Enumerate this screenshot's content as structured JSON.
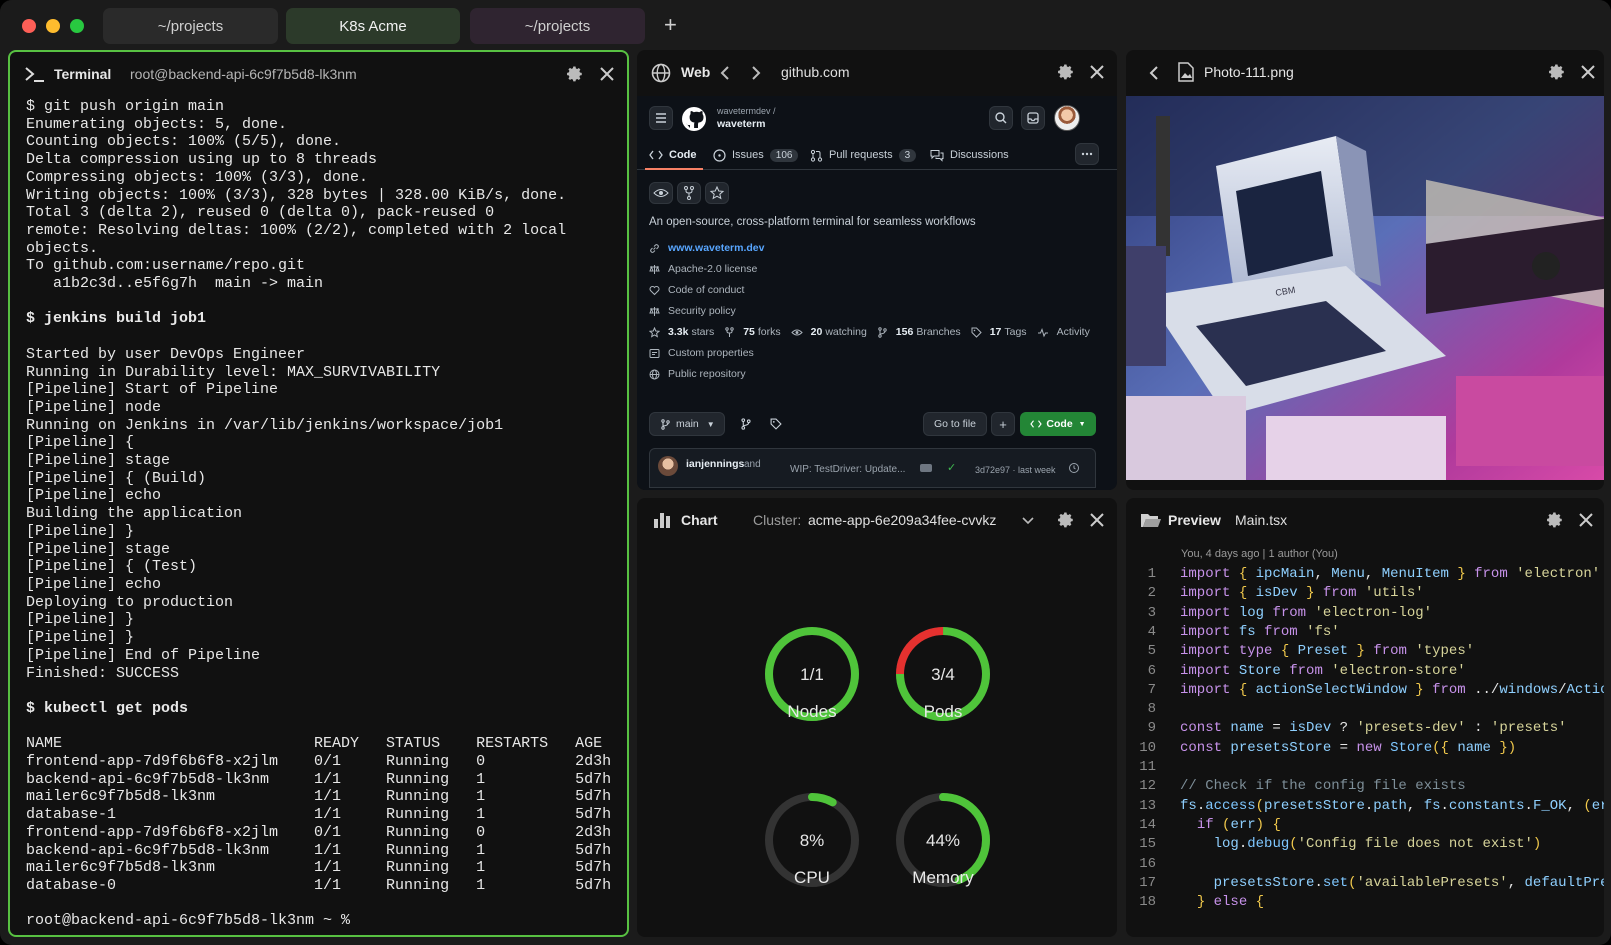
{
  "tabs": [
    {
      "label": "~/projects"
    },
    {
      "label": "K8s Acme"
    },
    {
      "label": "~/projects"
    }
  ],
  "new_tab": "+",
  "terminal": {
    "title": "Terminal",
    "host": "root@backend-api-6c9f7b5d8-lk3nm",
    "lines": [
      "$ git push origin main",
      "Enumerating objects: 5, done.",
      "Counting objects: 100% (5/5), done.",
      "Delta compression using up to 8 threads",
      "Compressing objects: 100% (3/3), done.",
      "Writing objects: 100% (3/3), 328 bytes | 328.00 KiB/s, done.",
      "Total 3 (delta 2), reused 0 (delta 0), pack-reused 0",
      "remote: Resolving deltas: 100% (2/2), completed with 2 local",
      "objects.",
      "To github.com:username/repo.git",
      "   a1b2c3d..e5f6g7h  main -> main",
      "",
      "$ jenkins build job1",
      "",
      "Started by user DevOps Engineer",
      "Running in Durability level: MAX_SURVIVABILITY",
      "[Pipeline] Start of Pipeline",
      "[Pipeline] node",
      "Running on Jenkins in /var/lib/jenkins/workspace/job1",
      "[Pipeline] {",
      "[Pipeline] stage",
      "[Pipeline] { (Build)",
      "[Pipeline] echo",
      "Building the application",
      "[Pipeline] }",
      "[Pipeline] stage",
      "[Pipeline] { (Test)",
      "[Pipeline] echo",
      "Deploying to production",
      "[Pipeline] }",
      "[Pipeline] }",
      "[Pipeline] End of Pipeline",
      "Finished: SUCCESS",
      "",
      "$ kubectl get pods",
      "",
      "NAME                            READY   STATUS    RESTARTS   AGE",
      "frontend-app-7d9f6b6f8-x2jlm    0/1     Running   0          2d3h",
      "backend-api-6c9f7b5d8-lk3nm     1/1     Running   1          5d7h",
      "mailer6c9f7b5d8-lk3nm           1/1     Running   1          5d7h",
      "database-1                      1/1     Running   1          5d7h",
      "frontend-app-7d9f6b6f8-x2jlm    0/1     Running   0          2d3h",
      "backend-api-6c9f7b5d8-lk3nm     1/1     Running   1          5d7h",
      "mailer6c9f7b5d8-lk3nm           1/1     Running   1          5d7h",
      "database-0                      1/1     Running   1          5d7h",
      "",
      "root@backend-api-6c9f7b5d8-lk3nm ~ %"
    ],
    "bold_lines": [
      12,
      34
    ]
  },
  "web": {
    "title": "Web",
    "url": "github.com",
    "github": {
      "owner": "wavetermdev /",
      "repo": "waveterm",
      "tabs": {
        "code": "Code",
        "issues": "Issues",
        "issues_count": "106",
        "pulls": "Pull requests",
        "pulls_count": "3",
        "discussions": "Discussions"
      },
      "description": "An open-source, cross-platform terminal for seamless workflows",
      "website": "www.waveterm.dev",
      "license": "Apache-2.0 license",
      "conduct": "Code of conduct",
      "security": "Security policy",
      "stars_n": "3.3k",
      "stars": "stars",
      "forks_n": "75",
      "forks": "forks",
      "watching_n": "20",
      "watching": "watching",
      "branches_n": "156",
      "branches": "Branches",
      "tags_n": "17",
      "tags": "Tags",
      "activity": "Activity",
      "custom": "Custom properties",
      "public": "Public repository",
      "branch": "main",
      "go_to_file": "Go to file",
      "add": "+",
      "code_btn": "Code",
      "commit_author": "ianjennings",
      "commit_and": "and",
      "commit_msg": "WIP: TestDriver: Update...",
      "commit_meta": "3d72e97 · last week"
    }
  },
  "photo": {
    "title": "Photo-111.png",
    "image_text": "CBM"
  },
  "chart": {
    "title": "Chart",
    "cluster_label": "Cluster:",
    "cluster_value": "acme-app-6e209a34fee-cvvkz",
    "colors": {
      "green": "#4fc43a",
      "red": "#e5312f",
      "track": "#333333"
    }
  },
  "chart_data": {
    "type": "gauge",
    "gauges": [
      {
        "name": "Nodes",
        "text": "1/1",
        "fraction": 1.0,
        "warn_fraction": 0
      },
      {
        "name": "Pods",
        "text": "3/4",
        "fraction": 0.75,
        "warn_fraction": 0.25
      },
      {
        "name": "CPU",
        "text": "8%",
        "fraction": 0.08,
        "warn_fraction": 0
      },
      {
        "name": "Memory",
        "text": "44%",
        "fraction": 0.44,
        "warn_fraction": 0
      }
    ]
  },
  "preview": {
    "title": "Preview",
    "file": "Main.tsx",
    "blame": "You, 4 days ago | 1 author (You)",
    "lines": [
      {
        "n": "1",
        "t": "import { ipcMain, Menu, MenuItem } from 'electron'"
      },
      {
        "n": "2",
        "t": "import { isDev } from 'utils'"
      },
      {
        "n": "3",
        "t": "import log from 'electron-log'"
      },
      {
        "n": "4",
        "t": "import fs from 'fs'"
      },
      {
        "n": "5",
        "t": "import type { Preset } from 'types'"
      },
      {
        "n": "6",
        "t": "import Store from 'electron-store'"
      },
      {
        "n": "7",
        "t": "import { actionSelectWindow } from '../windows/Action"
      },
      {
        "n": "8",
        "t": ""
      },
      {
        "n": "9",
        "t": "const name = isDev ? 'presets-dev' : 'presets'"
      },
      {
        "n": "10",
        "t": "const presetsStore = new Store({ name })"
      },
      {
        "n": "11",
        "t": ""
      },
      {
        "n": "12",
        "t": "// Check if the config file exists"
      },
      {
        "n": "13",
        "t": "fs.access(presetsStore.path, fs.constants.F_OK, (err)"
      },
      {
        "n": "14",
        "t": "  if (err) {"
      },
      {
        "n": "15",
        "t": "    log.debug('Config file does not exist')"
      },
      {
        "n": "16",
        "t": ""
      },
      {
        "n": "17",
        "t": "    presetsStore.set('availablePresets', defaultPrese"
      },
      {
        "n": "18",
        "t": "  } else {"
      }
    ]
  }
}
